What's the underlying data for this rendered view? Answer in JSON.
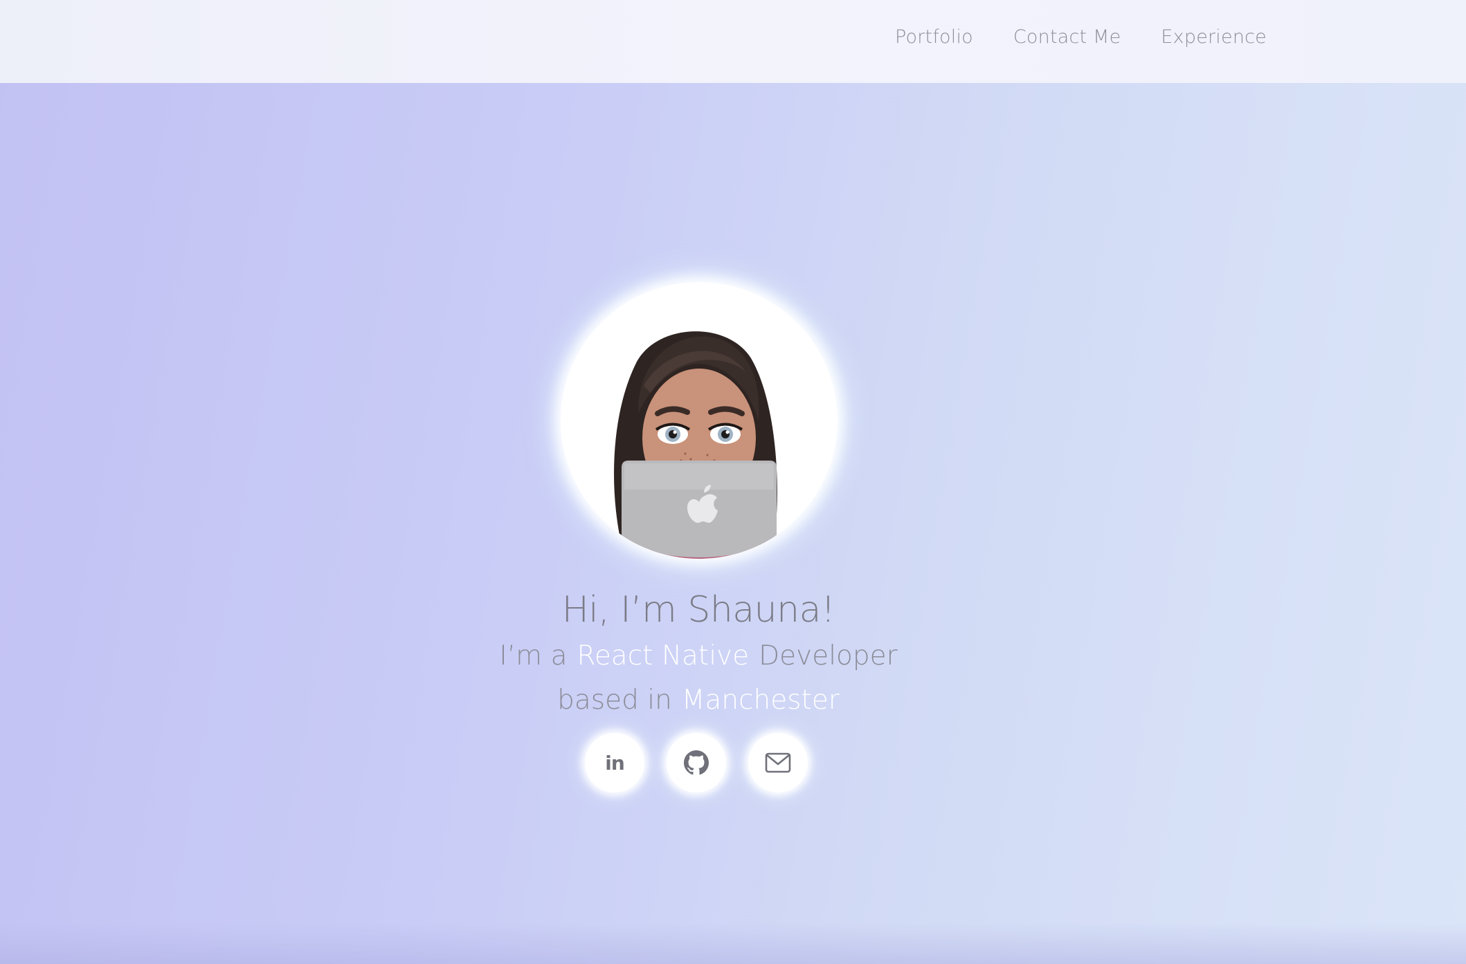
{
  "nav": {
    "links": [
      {
        "label": "Portfolio"
      },
      {
        "label": "Contact Me"
      },
      {
        "label": "Experience"
      }
    ]
  },
  "hero": {
    "greeting": "Hi, I’m Shauna!",
    "role_prefix": "I’m a",
    "role_highlight": "React Native",
    "role_suffix": "Developer",
    "location_prefix": "based in",
    "location_highlight": "Manchester"
  },
  "socials": [
    {
      "icon": "linkedin-icon",
      "label": "in"
    },
    {
      "icon": "github-icon"
    },
    {
      "icon": "mail-icon"
    }
  ],
  "colors": {
    "accent_text": "#ffffff",
    "muted_text": "#8b8c97",
    "nav_bg": "#f1f2fb"
  }
}
